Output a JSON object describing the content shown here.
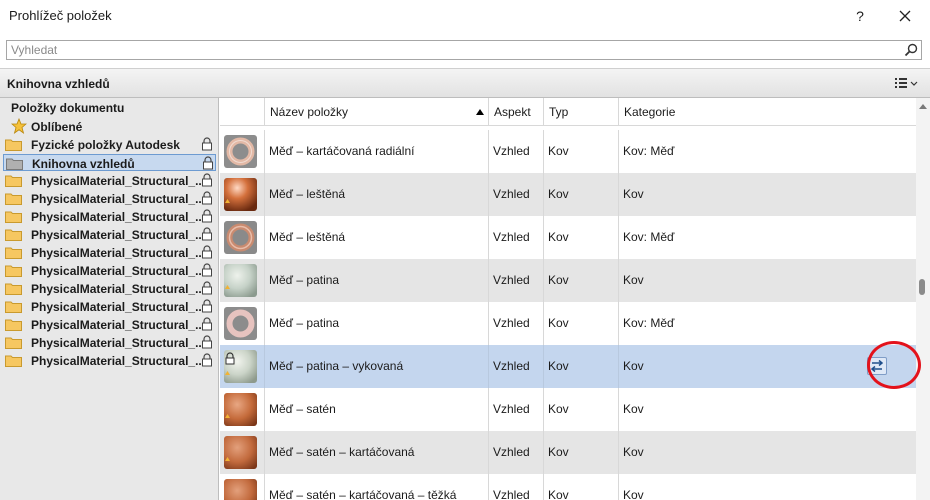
{
  "window": {
    "title": "Prohlížeč položek",
    "help_label": "?",
    "close_icon": "close-icon"
  },
  "search": {
    "placeholder": "Vyhledat",
    "icon": "search-icon"
  },
  "library": {
    "title": "Knihovna vzhledů",
    "view_icon": "list-view-icon"
  },
  "tree": {
    "heading": "Položky dokumentu",
    "items": [
      {
        "label": "Oblíbené",
        "icon": "star-icon",
        "locked": false
      },
      {
        "label": "Fyzické položky Autodesk",
        "icon": "folder-icon",
        "locked": true
      },
      {
        "label": "Knihovna vzhledů",
        "icon": "folder-icon",
        "locked": true,
        "selected": true
      },
      {
        "label": "PhysicalMaterial_Structural_...",
        "icon": "folder-icon",
        "locked": true
      },
      {
        "label": "PhysicalMaterial_Structural_...",
        "icon": "folder-icon",
        "locked": true
      },
      {
        "label": "PhysicalMaterial_Structural_...",
        "icon": "folder-icon",
        "locked": true
      },
      {
        "label": "PhysicalMaterial_Structural_...",
        "icon": "folder-icon",
        "locked": true
      },
      {
        "label": "PhysicalMaterial_Structural_...",
        "icon": "folder-icon",
        "locked": true
      },
      {
        "label": "PhysicalMaterial_Structural_...",
        "icon": "folder-icon",
        "locked": true
      },
      {
        "label": "PhysicalMaterial_Structural_...",
        "icon": "folder-icon",
        "locked": true
      },
      {
        "label": "PhysicalMaterial_Structural_...",
        "icon": "folder-icon",
        "locked": true
      },
      {
        "label": "PhysicalMaterial_Structural_...",
        "icon": "folder-icon",
        "locked": true
      },
      {
        "label": "PhysicalMaterial_Structural_...",
        "icon": "folder-icon",
        "locked": true
      },
      {
        "label": "PhysicalMaterial_Structural_...",
        "icon": "folder-icon",
        "locked": true
      }
    ]
  },
  "table": {
    "columns": [
      "Název položky",
      "Aspekt",
      "Typ",
      "Kategorie"
    ],
    "sort_column": "Název položky",
    "rows": [
      {
        "name": "Měď – kartáčovaná radiální",
        "aspect": "Vzhled",
        "type": "Kov",
        "category": "Kov: Měď",
        "thumb": "ring"
      },
      {
        "name": "Měď – leštěná",
        "aspect": "Vzhled",
        "type": "Kov",
        "category": "Kov",
        "thumb": "polished-sphere"
      },
      {
        "name": "Měď – leštěná",
        "aspect": "Vzhled",
        "type": "Kov",
        "category": "Kov: Měď",
        "thumb": "ring"
      },
      {
        "name": "Měď – patina",
        "aspect": "Vzhled",
        "type": "Kov",
        "category": "Kov",
        "thumb": "patina-sphere"
      },
      {
        "name": "Měď – patina",
        "aspect": "Vzhled",
        "type": "Kov",
        "category": "Kov: Měď",
        "thumb": "ring-rose"
      },
      {
        "name": "Měď – patina – vykovaná",
        "aspect": "Vzhled",
        "type": "Kov",
        "category": "Kov",
        "thumb": "patina-sphere-locked",
        "selected": true,
        "action_icon": "swap-arrows-icon"
      },
      {
        "name": "Měď – satén",
        "aspect": "Vzhled",
        "type": "Kov",
        "category": "Kov",
        "thumb": "satin-sphere"
      },
      {
        "name": "Měď – satén – kartáčovaná",
        "aspect": "Vzhled",
        "type": "Kov",
        "category": "Kov",
        "thumb": "satin-sphere"
      },
      {
        "name": "Měď – satén – kartáčovaná – těžká",
        "aspect": "Vzhled",
        "type": "Kov",
        "category": "Kov",
        "thumb": "satin-sphere"
      }
    ]
  },
  "colors": {
    "selection": "#c4d6ee",
    "alt_row": "#e5e5e5",
    "highlight_circle": "#e3121b",
    "copper": "#c46a3a"
  }
}
